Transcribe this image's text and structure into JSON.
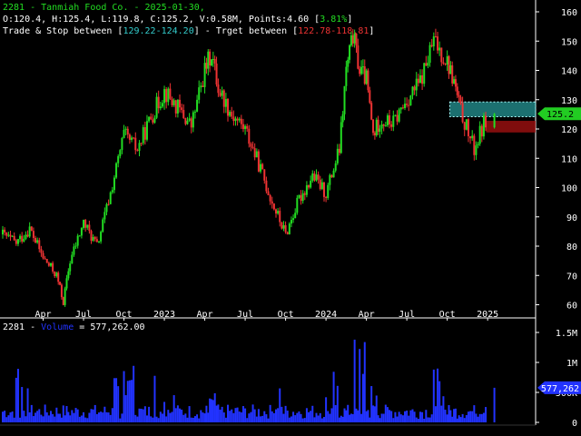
{
  "header": {
    "title_line": "2281 - Tanmiah Food Co. - 2025-01-30,",
    "ohlc_prefix": "O:120.4, H:125.4, L:119.8, C:125.2, V:0.58M, Points:4.60 [",
    "change_pct": "3.81%",
    "ohlc_suffix": "]",
    "trade_label": "Trade & Stop between [",
    "trade_range": "129.22-124.20",
    "target_label": "] - Trget between [",
    "target_range": "122.78-118.81",
    "target_suffix": "]"
  },
  "volume_header": {
    "prefix": "2281 - ",
    "name": "Volume",
    "value_text": " = 577,262.00"
  },
  "colors": {
    "background": "#000000",
    "up": "#22dd22",
    "down": "#ee3333",
    "trade_zone": "#33cccc",
    "target_zone": "#aa1111",
    "volume": "#2233ff",
    "axis": "#ffffff"
  },
  "chart_data": [
    {
      "type": "candlestick",
      "ylim": [
        55,
        165
      ],
      "y_ticks": [
        60,
        70,
        80,
        90,
        100,
        110,
        120,
        130,
        140,
        150,
        160
      ],
      "x_ticks": [
        "Apr",
        "Jul",
        "Oct",
        "2023",
        "Apr",
        "Jul",
        "Oct",
        "2024",
        "Apr",
        "Jul",
        "Oct",
        "2025"
      ],
      "last_price_label": "125.2",
      "last_close": 125.2,
      "trade_zone": [
        124.2,
        129.22
      ],
      "target_zone": [
        118.81,
        122.78
      ],
      "anchors": [
        {
          "x": "Jan 2022",
          "y": 84
        },
        {
          "x": "Feb 2022",
          "y": 81
        },
        {
          "x": "Mar 2022",
          "y": 86
        },
        {
          "x": "Apr 2022",
          "y": 76
        },
        {
          "x": "May 2022",
          "y": 70
        },
        {
          "x": "May 2022",
          "y": 61
        },
        {
          "x": "Jun 2022",
          "y": 75
        },
        {
          "x": "Jul 2022",
          "y": 88
        },
        {
          "x": "Aug 2022",
          "y": 80
        },
        {
          "x": "Sep 2022",
          "y": 98
        },
        {
          "x": "Oct 2022",
          "y": 118
        },
        {
          "x": "Nov 2022",
          "y": 113
        },
        {
          "x": "Dec 2022",
          "y": 124
        },
        {
          "x": "Jan 2023",
          "y": 133
        },
        {
          "x": "Feb 2023",
          "y": 127
        },
        {
          "x": "Mar 2023",
          "y": 121
        },
        {
          "x": "Apr 2023",
          "y": 140
        },
        {
          "x": "Apr 2023",
          "y": 146
        },
        {
          "x": "May 2023",
          "y": 134
        },
        {
          "x": "Jun 2023",
          "y": 125
        },
        {
          "x": "Jul 2023",
          "y": 120
        },
        {
          "x": "Aug 2023",
          "y": 108
        },
        {
          "x": "Sep 2023",
          "y": 95
        },
        {
          "x": "Oct 2023",
          "y": 84
        },
        {
          "x": "Nov 2023",
          "y": 96
        },
        {
          "x": "Dec 2023",
          "y": 104
        },
        {
          "x": "Jan 2024",
          "y": 98
        },
        {
          "x": "Feb 2024",
          "y": 113
        },
        {
          "x": "Feb 2024",
          "y": 140
        },
        {
          "x": "Mar 2024",
          "y": 152
        },
        {
          "x": "Mar 2024",
          "y": 140
        },
        {
          "x": "Apr 2024",
          "y": 137
        },
        {
          "x": "Apr 2024",
          "y": 118
        },
        {
          "x": "May 2024",
          "y": 123
        },
        {
          "x": "Jun 2024",
          "y": 122
        },
        {
          "x": "Jul 2024",
          "y": 130
        },
        {
          "x": "Aug 2024",
          "y": 136
        },
        {
          "x": "Sep 2024",
          "y": 150
        },
        {
          "x": "Oct 2024",
          "y": 143
        },
        {
          "x": "Oct 2024",
          "y": 136
        },
        {
          "x": "Nov 2024",
          "y": 126
        },
        {
          "x": "Dec 2024",
          "y": 113
        },
        {
          "x": "Jan 2025",
          "y": 125.2
        }
      ]
    },
    {
      "type": "bar",
      "name": "Volume",
      "ylim": [
        0,
        1600000
      ],
      "y_ticks": [
        "0",
        "500K",
        "1M",
        "1.5M"
      ],
      "last_volume_label": "577,262",
      "last_volume": 577262,
      "typical_volume": 200000,
      "spikes": [
        {
          "x": "Feb 2022",
          "value": 1100000
        },
        {
          "x": "Sep 2022",
          "value": 800000
        },
        {
          "x": "Oct 2022",
          "value": 1000000
        },
        {
          "x": "Dec 2022",
          "value": 850000
        },
        {
          "x": "Jan 2023",
          "value": 650000
        },
        {
          "x": "Apr 2023",
          "value": 550000
        },
        {
          "x": "Sep 2023",
          "value": 850000
        },
        {
          "x": "Jan 2024",
          "value": 900000
        },
        {
          "x": "Mar 2024",
          "value": 1560000
        },
        {
          "x": "Apr 2024",
          "value": 700000
        },
        {
          "x": "Sep 2024",
          "value": 900000
        },
        {
          "x": "Dec 2024",
          "value": 500000
        }
      ]
    }
  ]
}
